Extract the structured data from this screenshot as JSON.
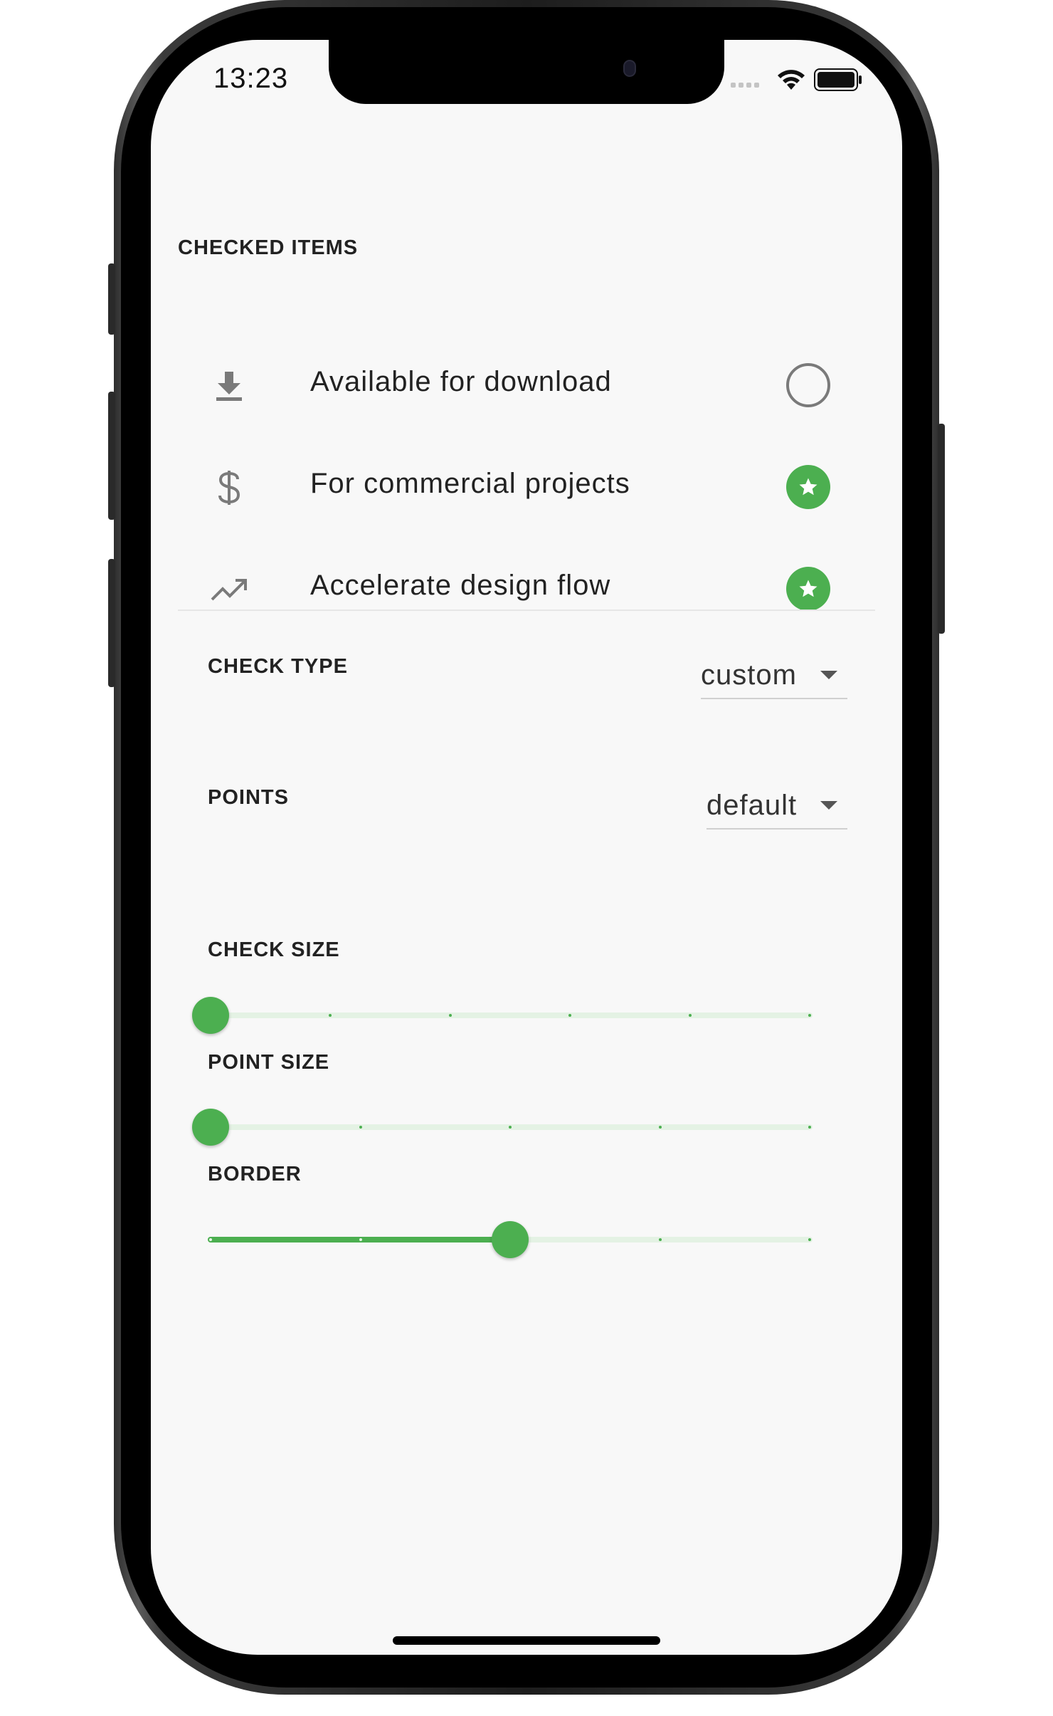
{
  "status_bar": {
    "time": "13:23"
  },
  "checked_items": {
    "title": "CHECKED ITEMS",
    "items": [
      {
        "icon": "download-icon",
        "label": "Available for download",
        "checked": false
      },
      {
        "icon": "dollar-icon",
        "label": "For commercial projects",
        "checked": true
      },
      {
        "icon": "trending-up-icon",
        "label": "Accelerate design flow",
        "checked": true
      }
    ]
  },
  "settings": {
    "check_type": {
      "label": "CHECK TYPE",
      "value": "custom"
    },
    "points": {
      "label": "POINTS",
      "value": "default"
    },
    "check_size": {
      "label": "CHECK SIZE",
      "value_fraction": 0.0,
      "divisions": 5
    },
    "point_size": {
      "label": "POINT SIZE",
      "value_fraction": 0.0,
      "divisions": 4
    },
    "border": {
      "label": "BORDER",
      "value_fraction": 0.5,
      "divisions": 4
    }
  },
  "colors": {
    "accent": "#4caf50",
    "track_inactive": "#e4f2e4",
    "background": "#f8f8f8"
  }
}
